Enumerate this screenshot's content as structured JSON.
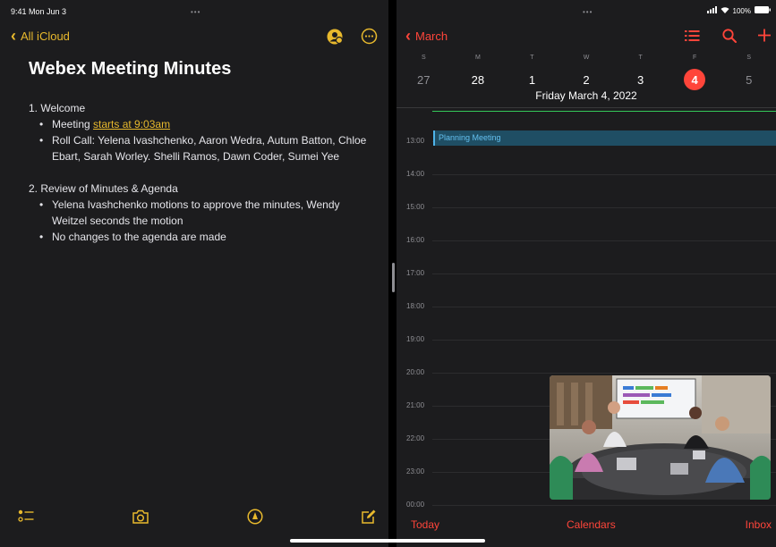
{
  "status_bar": {
    "time": "9:41 Mon Jun 3",
    "battery": "100%"
  },
  "notes": {
    "back_label": "All iCloud",
    "title": "Webex Meeting Minutes",
    "section1": {
      "heading": "1. Welcome",
      "bullet1_prefix": "Meeting ",
      "bullet1_link": "starts at 9:03am",
      "bullet2": "Roll Call: Yelena Ivashchenko, Aaron Wedra, Autum Batton, Chloe Ebart, Sarah Worley. Shelli Ramos, Dawn Coder, Sumei Yee"
    },
    "section2": {
      "heading": "2. Review of Minutes & Agenda",
      "bullet1": "Yelena Ivashchenko motions to approve the minutes, Wendy Weitzel seconds the motion",
      "bullet2": "No changes to the agenda are made"
    }
  },
  "calendar": {
    "back_label": "March",
    "weekday_letters": [
      "S",
      "M",
      "T",
      "W",
      "T",
      "F",
      "S"
    ],
    "days": [
      "27",
      "28",
      "1",
      "2",
      "3",
      "4",
      "5"
    ],
    "selected_date": "Friday  March 4, 2022",
    "hours": [
      "13:00",
      "14:00",
      "15:00",
      "16:00",
      "17:00",
      "18:00",
      "19:00",
      "20:00",
      "21:00",
      "22:00",
      "23:00",
      "00:00"
    ],
    "event": {
      "title": "Planning Meeting"
    },
    "tabs": {
      "today": "Today",
      "calendars": "Calendars",
      "inbox": "Inbox"
    }
  },
  "colors": {
    "notes_accent": "#e8b92d",
    "calendar_accent": "#ff453a",
    "event": "#1f4e64",
    "background": "#1c1c1e"
  }
}
